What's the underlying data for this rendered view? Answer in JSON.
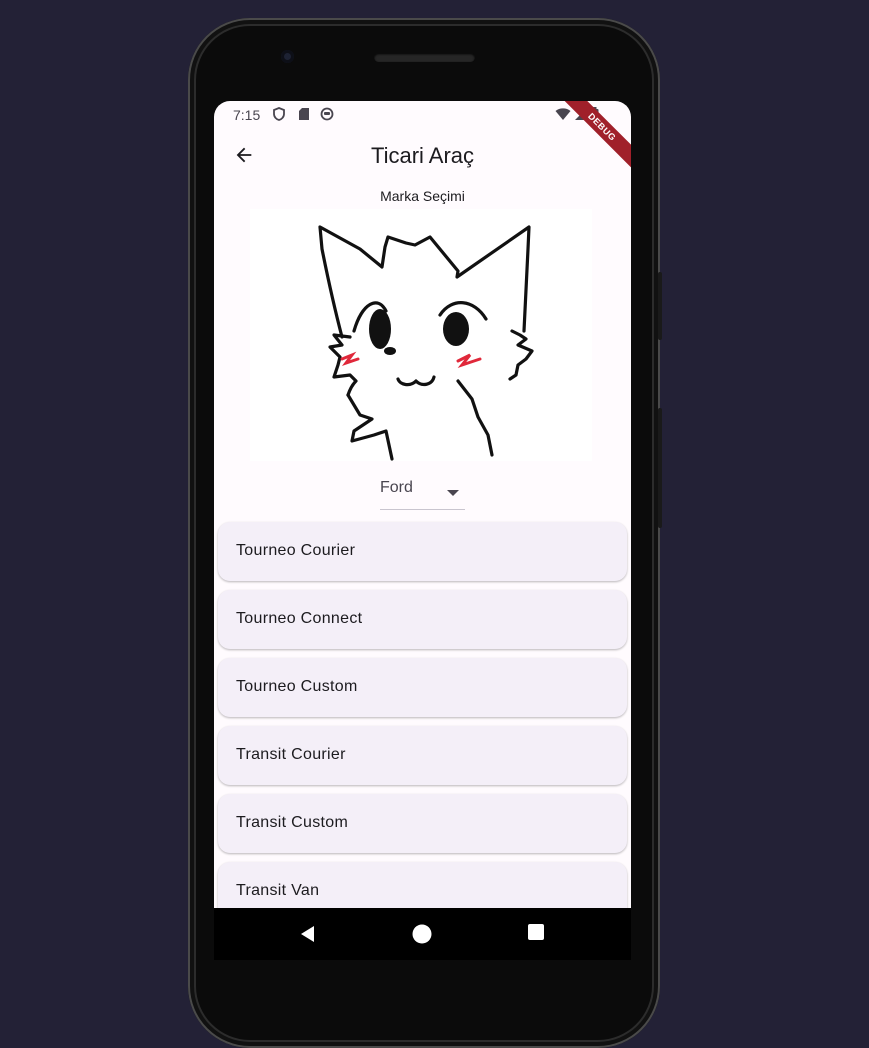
{
  "status_bar": {
    "time": "7:15",
    "left_icons": [
      "shield-icon",
      "sd-card-icon",
      "face-icon"
    ],
    "right_icons": [
      "wifi-icon",
      "signal-icon",
      "battery-icon"
    ]
  },
  "debug_banner": "DEBUG",
  "appbar": {
    "title": "Ticari Araç",
    "back_icon": "arrow-back-icon"
  },
  "subtitle": "Marka Seçimi",
  "brand_image": "cat-drawing-image",
  "dropdown": {
    "selected": "Ford",
    "icon": "arrow-drop-down-icon"
  },
  "models": [
    {
      "label": "Tourneo Courier"
    },
    {
      "label": "Tourneo Connect"
    },
    {
      "label": "Tourneo Custom"
    },
    {
      "label": "Transit Courier"
    },
    {
      "label": "Transit Custom"
    },
    {
      "label": "Transit Van"
    }
  ],
  "nav": [
    "back-triangle-icon",
    "home-circle-icon",
    "recents-square-icon"
  ],
  "colors": {
    "background": "#232136",
    "surface": "#fffbfe",
    "card": "#f4eff8",
    "text": "#1c1b1f",
    "debug": "#a0202a"
  }
}
